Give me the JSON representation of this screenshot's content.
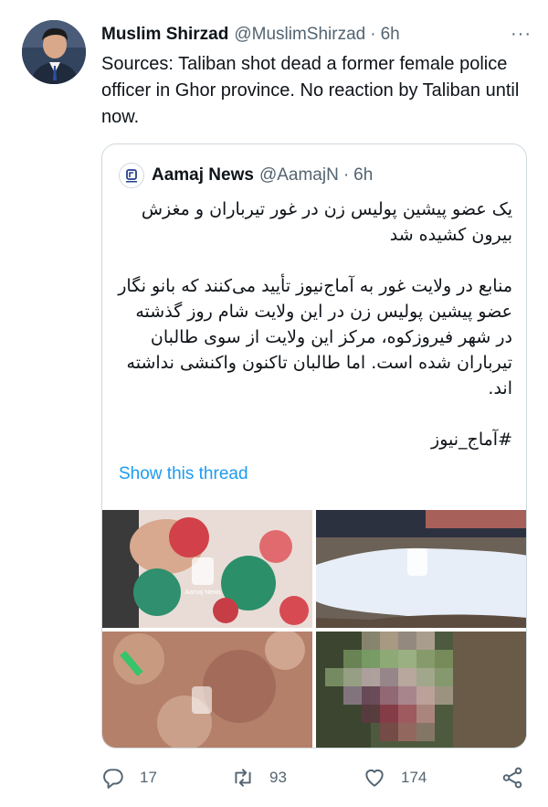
{
  "tweet": {
    "author": {
      "name": "Muslim Shirzad",
      "handle": "@MuslimShirzad",
      "time": "6h",
      "separator": "·"
    },
    "text": "Sources: Taliban shot dead a former female police officer in Ghor province. No reaction by Taliban until now.",
    "more_label": "···"
  },
  "quote": {
    "author": {
      "name": "Aamaj News",
      "handle": "@AamajN",
      "time": "6h",
      "separator": "·"
    },
    "paragraphs": [
      "یک عضو پیشین پولیس زن در غور تیرباران و مغزش بیرون کشیده شد",
      "منابع در ولایت غور به آماج‌نیوز تأیید می‌کنند که بانو نگار عضو پیشین پولیس زن در این ولایت شام روز گذشته در شهر فیروزکوه، مرکز این ولایت از سوی طالبان تیرباران شده است. اما طالبان تاکنون واکنشی نداشته اند.",
      "#آماج_نیوز"
    ],
    "show_thread": "Show this thread",
    "media_watermark": "Aamaj News"
  },
  "actions": {
    "replies": "17",
    "retweets": "93",
    "likes": "174"
  },
  "colors": {
    "text_primary": "#0f1419",
    "text_secondary": "#536471",
    "link": "#1d9bf0",
    "border": "#cfd9de"
  },
  "icons": [
    "more-icon",
    "reply-icon",
    "retweet-icon",
    "like-icon",
    "share-icon"
  ]
}
